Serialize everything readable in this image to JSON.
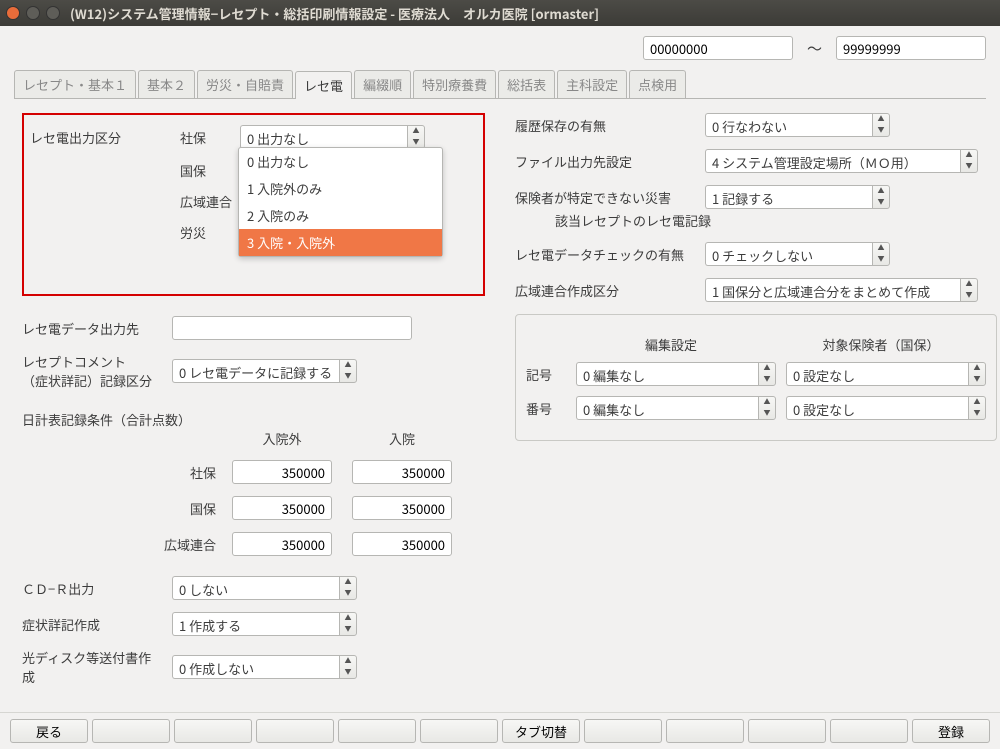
{
  "window_title": "(W12)システム管理情報−レセプト・総括印刷情報設定 - 医療法人　オルカ医院  [ormaster]",
  "range": {
    "from": "00000000",
    "tilde": "〜",
    "to": "99999999"
  },
  "tabs": [
    "レセプト・基本１",
    "基本２",
    "労災・自賠責",
    "レセ電",
    "編綴順",
    "特別療養費",
    "総括表",
    "主科設定",
    "点検用"
  ],
  "active_tab_index": 3,
  "left": {
    "section_label": "レセ電出力区分",
    "rows": {
      "shaho": {
        "label": "社保",
        "value": "0 出力なし"
      },
      "kokuho": {
        "label": "国保"
      },
      "koiki": {
        "label": "広域連合"
      },
      "rousai": {
        "label": "労災"
      }
    },
    "dropdown_options": [
      "0 出力なし",
      "1 入院外のみ",
      "2 入院のみ",
      "3 入院・入院外"
    ],
    "dropdown_selected_index": 3,
    "data_output_dest": {
      "label": "レセ電データ出力先",
      "value": ""
    },
    "comment_record": {
      "label1": "レセプトコメント",
      "label2": "（症状詳記）記録区分",
      "value": "0 レセ電データに記録する"
    },
    "tens": {
      "title": "日計表記録条件（合計点数）",
      "hdr1": "入院外",
      "hdr2": "入院",
      "lines": [
        {
          "lab": "社保",
          "v1": "350000",
          "v2": "350000"
        },
        {
          "lab": "国保",
          "v1": "350000",
          "v2": "350000"
        },
        {
          "lab": "広域連合",
          "v1": "350000",
          "v2": "350000"
        }
      ]
    },
    "cdr": {
      "label": "ＣＤ−Ｒ出力",
      "value": "0 しない"
    },
    "shoki": {
      "label": "症状詳記作成",
      "value": "1 作成する"
    },
    "hikari": {
      "label": "光ディスク等送付書作成",
      "value": "0 作成しない"
    }
  },
  "right": {
    "rireki": {
      "label": "履歴保存の有無",
      "value": "0 行なわない"
    },
    "fileout": {
      "label": "ファイル出力先設定",
      "value": "4 システム管理設定場所（ＭＯ用）"
    },
    "saigai": {
      "label1": "保険者が特定できない災害",
      "label2": "該当レセプトのレセ電記録",
      "value": "1 記録する"
    },
    "check": {
      "label": "レセ電データチェックの有無",
      "value": "0 チェックしない"
    },
    "koiki_kubun": {
      "label": "広域連合作成区分",
      "value": "1 国保分と広域連合分をまとめて作成"
    },
    "edit_box": {
      "hdr1": "編集設定",
      "hdr2": "対象保険者（国保）",
      "line1": {
        "lab": "記号",
        "v1": "0 編集なし",
        "v2": "0 設定なし"
      },
      "line2": {
        "lab": "番号",
        "v1": "0 編集なし",
        "v2": "0 設定なし"
      }
    }
  },
  "footer": {
    "back": "戻る",
    "tab_switch": "タブ切替",
    "register": "登録"
  }
}
